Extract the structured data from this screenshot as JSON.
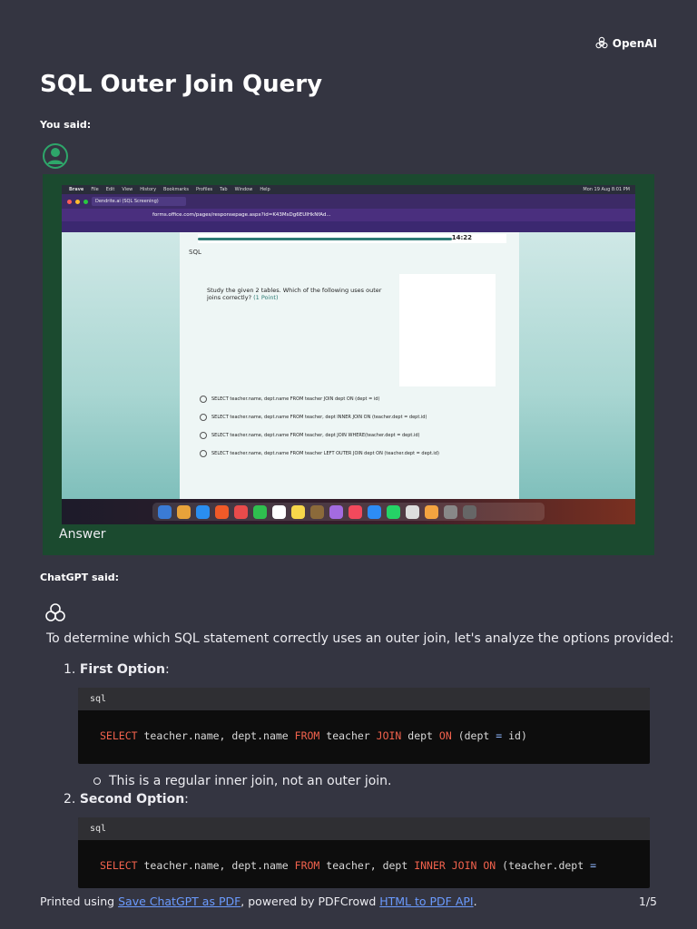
{
  "brand": {
    "name": "OpenAI"
  },
  "page": {
    "title": "SQL Outer Join Query"
  },
  "user": {
    "label": "You said:",
    "message": "Answer"
  },
  "screenshot": {
    "menu": [
      "Brave",
      "File",
      "Edit",
      "View",
      "History",
      "Bookmarks",
      "Profiles",
      "Tab",
      "Window",
      "Help"
    ],
    "clock": "Mon 19 Aug 8:01 PM",
    "tab_title": "Dendrite.ai (SQL Screening)",
    "url": "forms.office.com/pages/responsepage.aspx?id=K43MsDg6EUIHkNfAd...",
    "timer": "14:22",
    "section": "SQL",
    "question": "Study the given 2 tables. Which of the following uses outer joins correctly?",
    "points": "(1 Point)",
    "choices": [
      "SELECT teacher.name, dept.name FROM teacher JOIN dept ON (dept = id)",
      "SELECT teacher.name, dept.name FROM teacher, dept INNER JOIN ON (teacher.dept = dept.id)",
      "SELECT teacher.name, dept.name FROM teacher, dept JOIN WHERE(teacher.dept = dept.id)",
      "SELECT teacher.name, dept.name FROM teacher LEFT OUTER JOIN dept ON (teacher.dept = dept.id)"
    ]
  },
  "assistant": {
    "label": "ChatGPT said:",
    "intro": "To determine which SQL statement correctly uses an outer join, let's analyze the options provided:",
    "options": [
      {
        "number": "1.",
        "title": "First Option",
        "lang": "sql",
        "note": "This is a regular inner join, not an outer join."
      },
      {
        "number": "2.",
        "title": "Second Option",
        "lang": "sql"
      }
    ]
  },
  "footer": {
    "prefix": "Printed using ",
    "link1": "Save ChatGPT as PDF",
    "middle": ", powered by PDFCrowd ",
    "link2": "HTML to PDF API",
    "suffix": ".",
    "page": "1/5"
  },
  "colors": {
    "background": "#343541",
    "user_block": "#1b4a2f",
    "keyword": "#f2624d",
    "link": "#6b9bff"
  }
}
